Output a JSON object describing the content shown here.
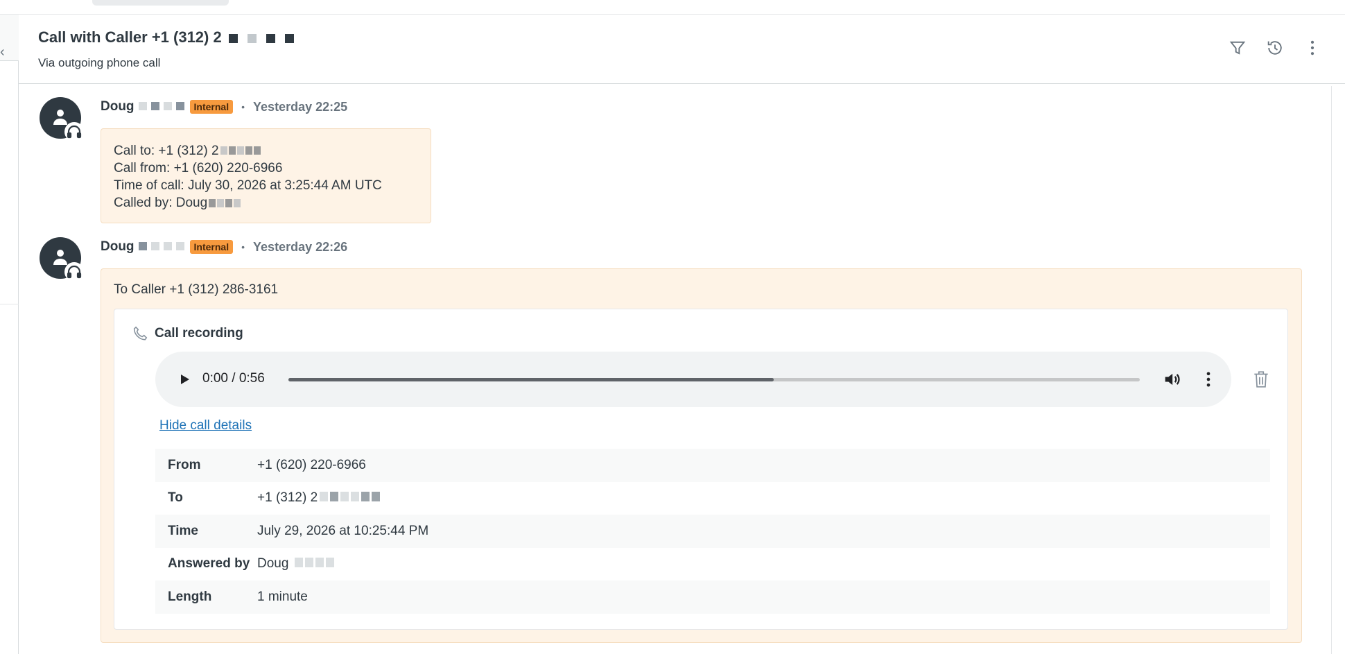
{
  "header": {
    "title": "Call with Caller +1 (312) 2",
    "subtitle": "Via outgoing phone call",
    "icons": [
      "filter-icon",
      "history-icon",
      "more-vertical-icon"
    ]
  },
  "messages": [
    {
      "author": "Doug",
      "badge": "Internal",
      "time": "Yesterday 22:25",
      "lines": {
        "call_to": "Call to: +1 (312) 2",
        "call_from": "Call from: +1 (620) 220-6966",
        "time_of_call": "Time of call: July 30, 2026 at 3:25:44 AM UTC",
        "called_by": "Called by: Doug"
      }
    },
    {
      "author": "Doug",
      "badge": "Internal",
      "time": "Yesterday 22:26",
      "to_line": "To Caller +1 (312) 286-3161",
      "recording": {
        "title": "Call recording",
        "time_display": "0:00 / 0:56",
        "progress_fraction": 0.57,
        "hide_link": "Hide call details",
        "details": [
          {
            "label": "From",
            "value": "+1 (620) 220-6966"
          },
          {
            "label": "To",
            "value": "+1 (312) 2"
          },
          {
            "label": "Time",
            "value": "July 29, 2026 at 10:25:44 PM"
          },
          {
            "label": "Answered by",
            "value": "Doug"
          },
          {
            "label": "Length",
            "value": "1 minute"
          }
        ]
      }
    }
  ],
  "colors": {
    "badge": "#f79a3e",
    "bubble_bg": "#fef3e6",
    "link": "#1f73b7",
    "text": "#2f3941"
  }
}
